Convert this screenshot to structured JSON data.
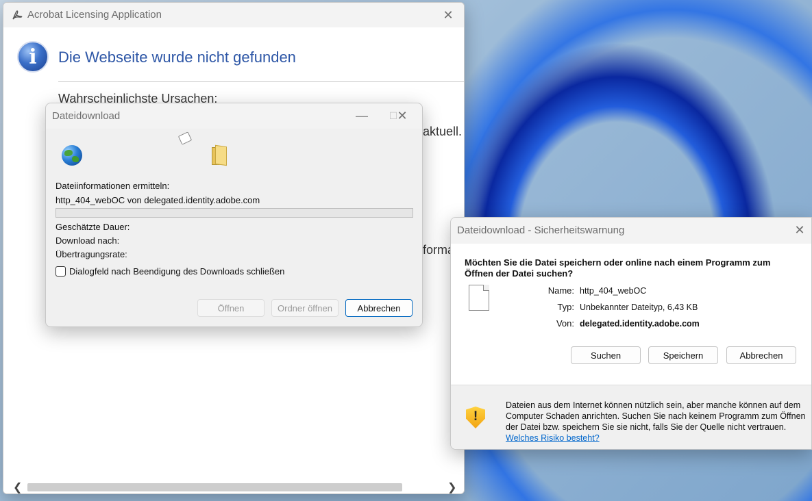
{
  "acrobat": {
    "title": "Acrobat Licensing Application",
    "heading": "Die Webseite wurde nicht gefunden",
    "subheading": "Wahrscheinlichste Ursachen:",
    "fragment_1": "aktuell.",
    "fragment_2": "forma",
    "close_glyph": "✕"
  },
  "download": {
    "title": "Dateidownload",
    "status": "Dateiinformationen ermitteln:",
    "source": "http_404_webOC von delegated.identity.adobe.com",
    "eta_label": "Geschätzte Dauer:",
    "target_label": "Download nach:",
    "rate_label": "Übertragungsrate:",
    "progress": 0,
    "close_checkbox_label": "Dialogfeld nach Beendigung des Downloads schließen",
    "close_checkbox_checked": false,
    "open_button": "Öffnen",
    "open_folder_button": "Ordner öffnen",
    "cancel_button": "Abbrechen",
    "minimize_glyph": "—",
    "maximize_glyph": "☐",
    "close_glyph": "✕"
  },
  "security": {
    "title": "Dateidownload - Sicherheitswarnung",
    "question": "Möchten Sie die Datei speichern oder online nach einem Programm zum Öffnen der Datei suchen?",
    "name_label": "Name:",
    "name_value": "http_404_webOC",
    "type_label": "Typ:",
    "type_value": "Unbekannter Dateityp, 6,43 KB",
    "from_label": "Von:",
    "from_value": "delegated.identity.adobe.com",
    "search_button": "Suchen",
    "save_button": "Speichern",
    "cancel_button": "Abbrechen",
    "warning_text": "Dateien aus dem Internet können nützlich sein, aber manche können auf dem Computer Schaden anrichten. Suchen Sie nach keinem Programm zum Öffnen der Datei bzw. speichern Sie sie nicht, falls Sie der Quelle nicht vertrauen.",
    "risk_link": "Welches Risiko besteht?",
    "close_glyph": "✕"
  },
  "colors": {
    "heading_blue": "#2d56a6",
    "link_blue": "#0066cc",
    "default_button_border": "#0067c0"
  }
}
